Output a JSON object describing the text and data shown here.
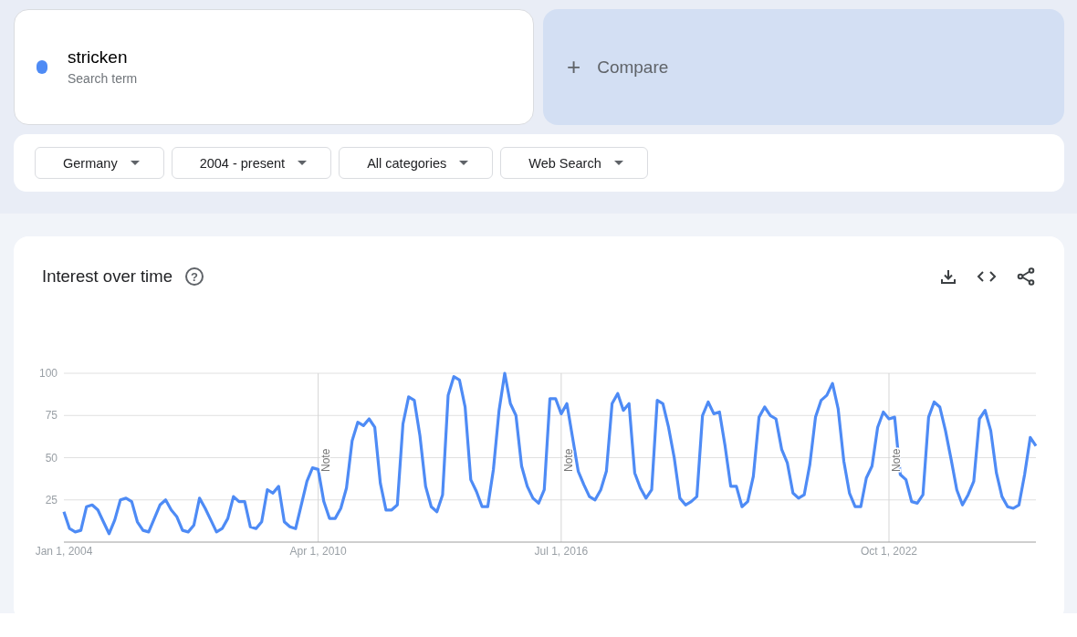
{
  "search_term": {
    "term": "stricken",
    "subtitle": "Search term",
    "color": "#4e8bf5"
  },
  "compare": {
    "icon": "+",
    "label": "Compare"
  },
  "filters": [
    {
      "label": "Germany"
    },
    {
      "label": "2004 - present"
    },
    {
      "label": "All categories"
    },
    {
      "label": "Web Search"
    }
  ],
  "interest_over_time": {
    "title": "Interest over time",
    "help_icon": "?",
    "chart_data": {
      "type": "line",
      "grid": true,
      "ylim": [
        0,
        100
      ],
      "yticks": [
        25,
        50,
        75,
        100
      ],
      "categories": [
        "Jan 1, 2004",
        null,
        null,
        null,
        null,
        null,
        null,
        null,
        null,
        null,
        null,
        null,
        null,
        null,
        null,
        null,
        null,
        null,
        null,
        null,
        null,
        null,
        null,
        null,
        null,
        null,
        null,
        null,
        null,
        null,
        null,
        null,
        null,
        null,
        null,
        null,
        null,
        null,
        null,
        null,
        null,
        null,
        null,
        null,
        null,
        "Apr 1, 2010",
        null,
        null,
        null,
        null,
        null,
        null,
        null,
        null,
        null,
        null,
        null,
        null,
        null,
        null,
        null,
        null,
        null,
        null,
        null,
        null,
        null,
        null,
        null,
        null,
        null,
        null,
        null,
        null,
        null,
        null,
        null,
        null,
        null,
        null,
        null,
        null,
        null,
        null,
        null,
        null,
        null,
        null,
        "Jul 1, 2016",
        null,
        null,
        null,
        null,
        null,
        null,
        null,
        null,
        null,
        null,
        null,
        null,
        null,
        null,
        null,
        null,
        null,
        null,
        null,
        null,
        null,
        null,
        null,
        null,
        null,
        null,
        null,
        null,
        null,
        null,
        null,
        null,
        null,
        null,
        null,
        null,
        null,
        null,
        null,
        null,
        null,
        null,
        null,
        null,
        null,
        null,
        null,
        null,
        null,
        null,
        null,
        null,
        null,
        null,
        null,
        null,
        null,
        "Oct 1, 2022",
        null,
        null,
        null,
        null,
        null,
        null,
        null,
        null,
        null,
        null,
        null,
        null,
        null,
        null,
        null,
        null,
        null,
        null,
        null,
        null,
        null,
        null,
        null,
        null,
        null,
        null
      ],
      "annotations": [
        "Note",
        "Note",
        "Note"
      ],
      "series": [
        {
          "color": "#4e8bf5",
          "values": [
            18,
            8,
            6,
            7,
            21,
            22,
            19,
            12,
            5,
            13,
            25,
            26,
            24,
            12,
            7,
            6,
            14,
            22,
            25,
            19,
            15,
            7,
            6,
            10,
            26,
            20,
            13,
            6,
            8,
            14,
            27,
            24,
            24,
            9,
            8,
            12,
            31,
            29,
            33,
            12,
            9,
            8,
            22,
            36,
            44,
            43,
            24,
            14,
            14,
            20,
            32,
            60,
            71,
            69,
            73,
            68,
            35,
            19,
            19,
            22,
            70,
            86,
            84,
            63,
            33,
            21,
            18,
            28,
            87,
            98,
            96,
            80,
            37,
            30,
            21,
            21,
            43,
            78,
            100,
            82,
            75,
            45,
            33,
            26,
            23,
            31,
            85,
            85,
            76,
            82,
            62,
            42,
            34,
            27,
            25,
            31,
            42,
            82,
            88,
            78,
            82,
            41,
            32,
            26,
            31,
            84,
            82,
            68,
            50,
            26,
            22,
            24,
            27,
            75,
            83,
            76,
            77,
            57,
            33,
            33,
            21,
            24,
            39,
            74,
            80,
            75,
            73,
            55,
            47,
            29,
            26,
            28,
            46,
            74,
            84,
            87,
            94,
            79,
            48,
            29,
            21,
            21,
            38,
            45,
            68,
            77,
            73,
            74,
            40,
            37,
            24,
            23,
            28,
            74,
            83,
            80,
            66,
            49,
            31,
            22,
            28,
            36,
            73,
            78,
            66,
            41,
            27,
            21,
            20,
            22,
            40,
            62,
            57
          ]
        }
      ]
    }
  }
}
